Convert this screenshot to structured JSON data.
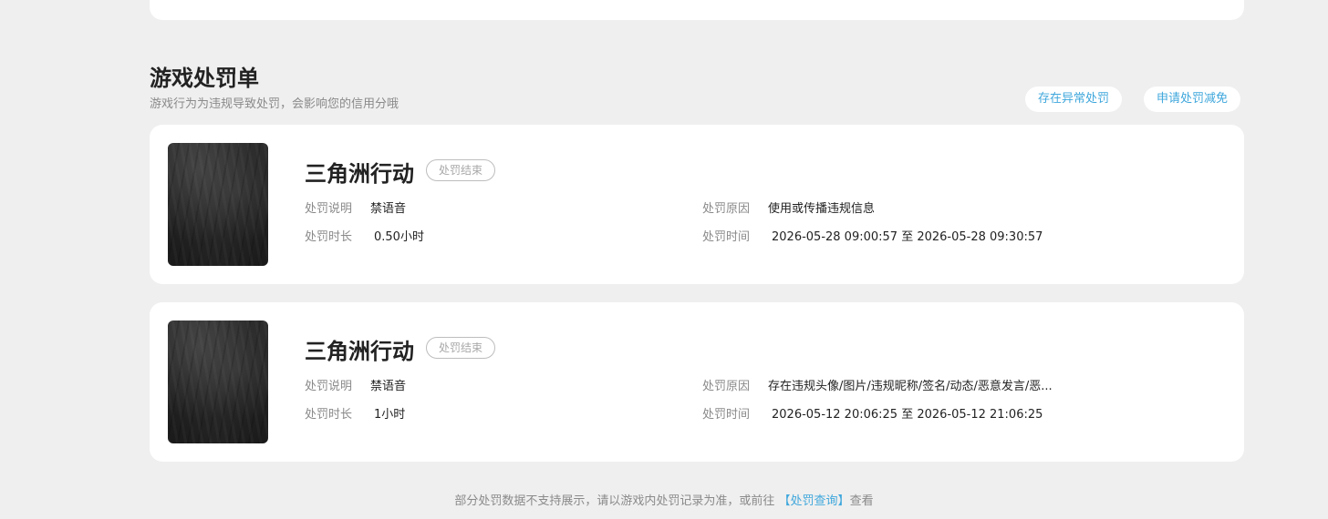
{
  "section": {
    "title": "游戏处罚单",
    "subtitle": "游戏行为为违规导致处罚，会影响您的信用分哦"
  },
  "actions": {
    "abnormal_label": "存在异常处罚",
    "reduce_label": "申请处罚减免"
  },
  "records": [
    {
      "game": "三角洲行动",
      "status": "处罚结束",
      "desc_label": "处罚说明",
      "desc_value": "禁语音",
      "duration_label": "处罚时长",
      "duration_value": "0.50小时",
      "reason_label": "处罚原因",
      "reason_value": "使用或传播违规信息",
      "time_label": "处罚时间",
      "time_value": "2026-05-28 09:00:57 至 2026-05-28 09:30:57"
    },
    {
      "game": "三角洲行动",
      "status": "处罚结束",
      "desc_label": "处罚说明",
      "desc_value": "禁语音",
      "duration_label": "处罚时长",
      "duration_value": "1小时",
      "reason_label": "处罚原因",
      "reason_value": "存在违规头像/图片/违规昵称/签名/动态/恶意发言/恶...",
      "time_label": "处罚时间",
      "time_value": "2026-05-12 20:06:25 至 2026-05-12 21:06:25"
    }
  ],
  "footer": {
    "text_before": "部分处罚数据不支持展示，请以游戏内处罚记录为准，或前往 ",
    "link": "【处罚查询】",
    "text_after": "查看"
  },
  "colors": {
    "accent": "#3fa7dc",
    "background": "#efefef"
  }
}
